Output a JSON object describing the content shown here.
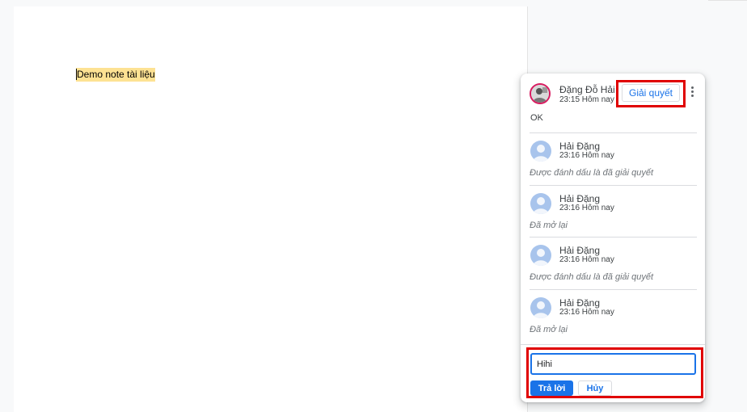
{
  "document": {
    "text": "Demo note tài liệu",
    "highlight_color": "#fde293"
  },
  "comment_thread": {
    "author": "Đặng Đỗ Hải",
    "time": "23:15 Hôm nay",
    "resolve_label": "Giải quyết",
    "body": "OK",
    "avatar_icon": "user-photo-avatar",
    "replies": [
      {
        "author": "Hải Đặng",
        "time": "23:16 Hôm nay",
        "status": "Được đánh dấu là đã giải quyết"
      },
      {
        "author": "Hải Đặng",
        "time": "23:16 Hôm nay",
        "status": "Đã mở lại"
      },
      {
        "author": "Hải Đặng",
        "time": "23:16 Hôm nay",
        "status": "Được đánh dấu là đã giải quyết"
      },
      {
        "author": "Hải Đặng",
        "time": "23:16 Hôm nay",
        "status": "Đã mở lại"
      }
    ],
    "reply_box": {
      "value": "Hihi",
      "submit_label": "Trả lời",
      "cancel_label": "Hủy"
    }
  },
  "colors": {
    "accent": "#1a73e8",
    "annotation_box": "#e00000",
    "avatar_default": "#a8c4ec"
  }
}
